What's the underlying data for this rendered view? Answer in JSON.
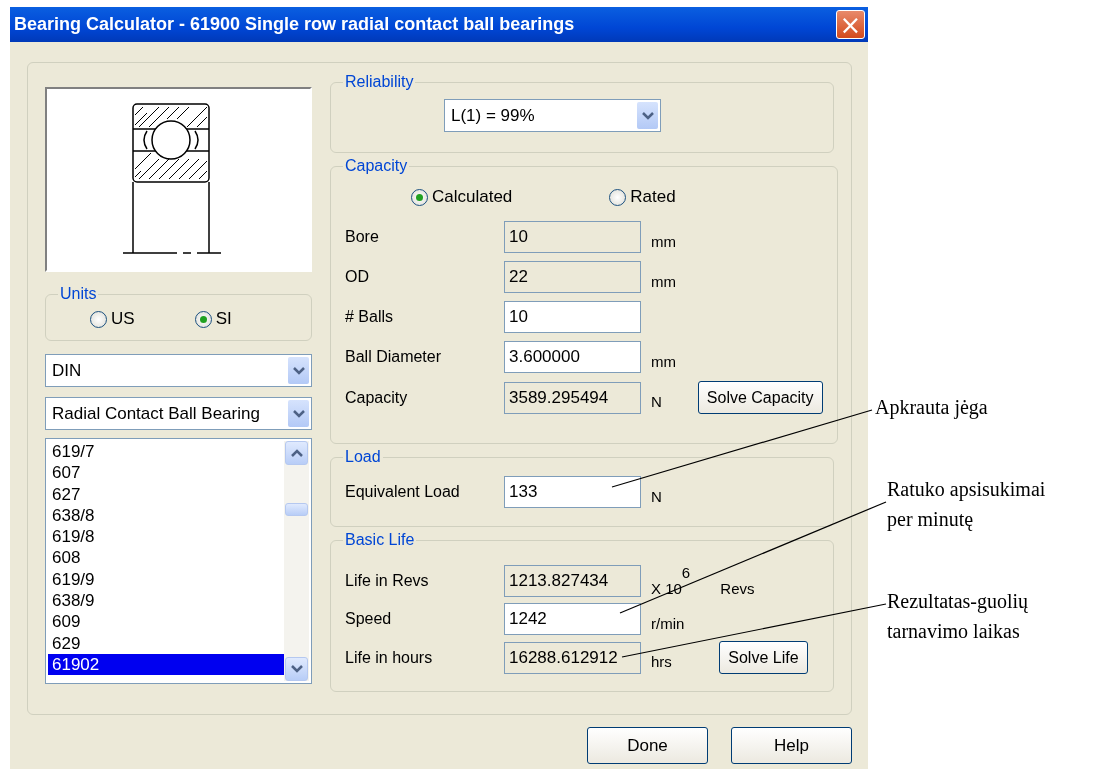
{
  "window": {
    "title": "Bearing Calculator - 61900 Single row radial contact ball bearings",
    "close": "×"
  },
  "units": {
    "label": "Units",
    "options": [
      {
        "label": "US",
        "selected": false
      },
      {
        "label": "SI",
        "selected": true
      }
    ]
  },
  "standard_dropdown": {
    "value": "DIN"
  },
  "type_dropdown": {
    "value": "Radial Contact Ball Bearing"
  },
  "bearing_list": {
    "items": [
      {
        "label": "619/7",
        "selected": false
      },
      {
        "label": "607",
        "selected": false
      },
      {
        "label": "627",
        "selected": false
      },
      {
        "label": "638/8",
        "selected": false
      },
      {
        "label": "619/8",
        "selected": false
      },
      {
        "label": "608",
        "selected": false
      },
      {
        "label": "619/9",
        "selected": false
      },
      {
        "label": "638/9",
        "selected": false
      },
      {
        "label": "609",
        "selected": false
      },
      {
        "label": "629",
        "selected": false
      },
      {
        "label": "61902",
        "selected": true
      }
    ]
  },
  "reliability": {
    "label": "Reliability",
    "value": "L(1) = 99%"
  },
  "capacity": {
    "label": "Capacity",
    "modes": [
      {
        "label": "Calculated",
        "selected": true
      },
      {
        "label": "Rated",
        "selected": false
      }
    ],
    "fields": [
      {
        "label": "Bore",
        "value": "10",
        "unit": "mm",
        "readonly": true
      },
      {
        "label": "OD",
        "value": "22",
        "unit": "mm",
        "readonly": true
      },
      {
        "label": "# Balls",
        "value": "10",
        "readonly": false
      },
      {
        "label": "Ball Diameter",
        "value": "3.600000",
        "unit": "mm",
        "readonly": false
      },
      {
        "label": "Capacity",
        "value": "3589.295494",
        "unit": "N",
        "readonly": true,
        "button": "Solve Capacity"
      }
    ]
  },
  "load": {
    "label": "Load",
    "fields": [
      {
        "label": "Equivalent Load",
        "value": "133",
        "unit": "N",
        "readonly": false
      }
    ]
  },
  "basic_life": {
    "label": "Basic Life",
    "fields": [
      {
        "label": "Life in Revs",
        "value": "1213.827434",
        "unit": "X 10$^{6}$ Revs",
        "readonly": true
      },
      {
        "label": "Speed",
        "value": "1242",
        "unit": "r/min",
        "readonly": false
      },
      {
        "label": "Life in hours",
        "value": "16288.612912",
        "unit": "hrs",
        "readonly": true,
        "button": "Solve Life"
      }
    ]
  },
  "buttons": [
    "Done",
    "Help"
  ],
  "annotations": [
    {
      "text": "Apkrauta jėga"
    },
    {
      "text": "Ratuko apsisukimai\nper minutę"
    },
    {
      "text": "Rezultatas-guolių\ntarnavimo laikas"
    }
  ]
}
